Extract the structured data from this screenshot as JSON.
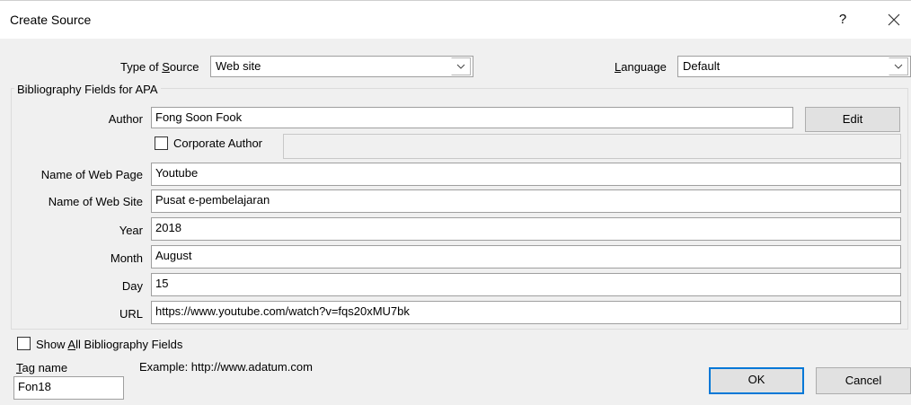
{
  "window": {
    "title": "Create Source",
    "help_label": "?",
    "close_icon": "close-icon"
  },
  "source_type": {
    "label_pre": "Type of ",
    "label_accel": "S",
    "label_post": "ource",
    "value": "Web site"
  },
  "language": {
    "label_accel": "L",
    "label_post": "anguage",
    "value": "Default"
  },
  "group": {
    "title": "Bibliography Fields for APA"
  },
  "author": {
    "label": "Author",
    "value": "Fong Soon Fook",
    "edit_label": "Edit"
  },
  "corporate_author": {
    "label": "Corporate Author",
    "checked": false,
    "value": ""
  },
  "fields": {
    "web_page": {
      "label": "Name of Web Page",
      "value": "Youtube"
    },
    "web_site": {
      "label": "Name of Web Site",
      "value": "Pusat e-pembelajaran"
    },
    "year": {
      "label": "Year",
      "value": "2018"
    },
    "month": {
      "label": "Month",
      "value": "August"
    },
    "day": {
      "label": "Day",
      "value": "15"
    },
    "url": {
      "label": "URL",
      "value": "https://www.youtube.com/watch?v=fqs20xMU7bk"
    }
  },
  "show_all": {
    "label_pre": "Show ",
    "label_accel": "A",
    "label_post": "ll Bibliography Fields",
    "checked": false
  },
  "tag": {
    "label_accel": "T",
    "label_post": "ag name",
    "value": "Fon18"
  },
  "example": {
    "text": "Example: http://www.adatum.com"
  },
  "buttons": {
    "ok": "OK",
    "cancel": "Cancel"
  },
  "colors": {
    "accent": "#0078d7",
    "dialog_bg": "#f0f0f0"
  }
}
